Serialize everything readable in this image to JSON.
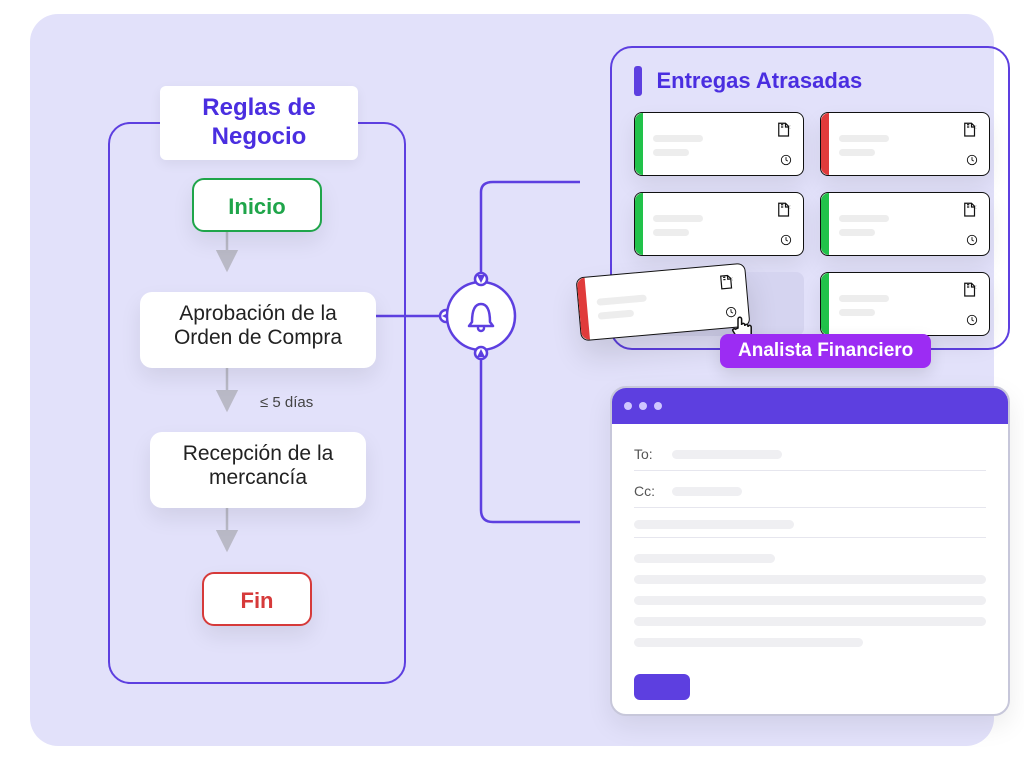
{
  "rules": {
    "title": "Reglas de Negocio",
    "start_label": "Inicio",
    "step1_label": "Aprobación de la Orden de Compra",
    "sla_label": "≤ 5 días",
    "step2_label": "Recepción de la mercancía",
    "end_label": "Fin"
  },
  "deliveries": {
    "title": "Entregas Atrasadas",
    "cards": [
      {
        "stripe": "green"
      },
      {
        "stripe": "red"
      },
      {
        "stripe": "green"
      },
      {
        "stripe": "green"
      },
      {
        "stripe": "green"
      }
    ],
    "drag_card": {
      "stripe": "red"
    }
  },
  "role": {
    "label": "Analista Financiero"
  },
  "mail": {
    "to_label": "To:",
    "cc_label": "Cc:"
  }
}
